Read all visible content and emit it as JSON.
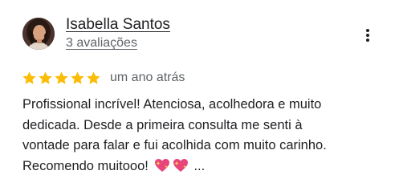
{
  "reviewer": {
    "name": "Isabella Santos",
    "review_count": "3 avaliações"
  },
  "review": {
    "rating": 5,
    "rating_max": 5,
    "date": "um ano atrás",
    "lines": [
      "Profissional incrível! Atenciosa, acolhedora e muito",
      "dedicada. Desde a primeira consulta me senti à",
      "vontade para falar e fui acolhida com muito carinho.",
      "Recomendo muitooo!"
    ],
    "truncation": "...",
    "emoji_icons": [
      "sparkling-heart-icon",
      "sparkling-heart-icon"
    ]
  },
  "colors": {
    "star": "#fbbc04",
    "text_primary": "#202124",
    "text_secondary": "#5f6368",
    "heart": "#e8457a"
  },
  "icons": {
    "more": "more-vert-icon",
    "star": "star-icon"
  }
}
